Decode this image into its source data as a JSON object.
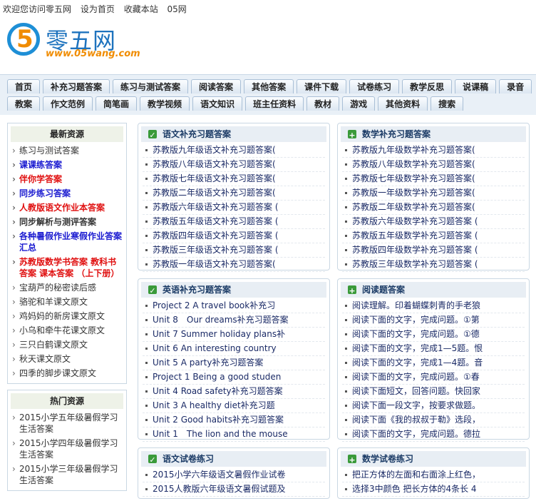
{
  "topbar": [
    "欢迎您访问零五网",
    "设为首页",
    "收藏本站",
    "05网"
  ],
  "logo": {
    "digit": "5",
    "name": "零五网",
    "domain": "www.05wang.com"
  },
  "nav": {
    "row1": [
      "首页",
      "补充习题答案",
      "练习与测试答案",
      "阅读答案",
      "其他答案",
      "课件下载",
      "试卷练习",
      "教学反思",
      "说课稿",
      "录音"
    ],
    "row2": [
      "教案",
      "作文范例",
      "简笔画",
      "教学视频",
      "语文知识",
      "班主任资料",
      "教材",
      "游戏",
      "其他资料",
      "搜索"
    ]
  },
  "sidebar": {
    "latest": {
      "title": "最新资源",
      "items": [
        {
          "text": "练习与测试答案",
          "style": "plain"
        },
        {
          "text": "课课练答案",
          "style": "blue"
        },
        {
          "text": "伴你学答案",
          "style": "red"
        },
        {
          "text": "同步练习答案",
          "style": "blue"
        },
        {
          "text": "人教版语文作业本答案",
          "style": "red"
        },
        {
          "text": "同步解析与测评答案",
          "style": "bold"
        },
        {
          "text": "各种暑假作业寒假作业答案汇总",
          "style": "blue"
        },
        {
          "text": "苏教版数学书答案 教科书答案 课本答案 （上下册）",
          "style": "red"
        },
        {
          "text": "宝葫芦的秘密读后感",
          "style": "plain"
        },
        {
          "text": "骆驼和羊课文原文",
          "style": "plain"
        },
        {
          "text": "鸡妈妈的新房课文原文",
          "style": "plain"
        },
        {
          "text": "小乌和牵牛花课文原文",
          "style": "plain"
        },
        {
          "text": "三只白鹤课文原文",
          "style": "plain"
        },
        {
          "text": "秋天课文原文",
          "style": "plain"
        },
        {
          "text": "四季的脚步课文原文",
          "style": "plain"
        }
      ]
    },
    "hot": {
      "title": "热门资源",
      "items": [
        "2015小学五年级暑假学习生活答案",
        "2015小学四年级暑假学习生活答案",
        "2015小学三年级暑假学习生活答案"
      ]
    }
  },
  "panels": [
    {
      "title": "语文补充习题答案",
      "icon": "check-icon",
      "items": [
        "苏教版九年级语文补充习题答案(",
        "苏教版八年级语文补充习题答案(",
        "苏教版七年级语文补充习题答案(",
        "苏教版二年级语文补充习题答案(",
        "苏教版六年级语文补充习题答案 (",
        "苏教版五年级语文补充习题答案 (",
        "苏教版四年级语文补充习题答案 (",
        "苏教版三年级语文补充习题答案 (",
        "苏教版一年级语文补充习题答案("
      ]
    },
    {
      "title": "数学补充习题答案",
      "icon": "plus-icon",
      "items": [
        "苏教版九年级数学补充习题答案(",
        "苏教版八年级数学补充习题答案(",
        "苏教版七年级数学补充习题答案(",
        "苏教版一年级数学补充习题答案(",
        "苏教版二年级数学补充习题答案(",
        "苏教版六年级数学补充习题答案 (",
        "苏教版五年级数学补充习题答案 (",
        "苏教版四年级数学补充习题答案 (",
        "苏教版三年级数学补充习题答案 ("
      ]
    },
    {
      "title": "英语补充习题答案",
      "icon": "check-icon",
      "items": [
        "Project 2 A travel book补充习",
        "Unit 8　Our dreams补充习题答案",
        "Unit 7 Summer holiday plans补",
        "Unit 6 An interesting country",
        "Unit 5 A party补充习题答案",
        "Project 1 Being a good studen",
        "Unit 4 Road safety补充习题答案",
        "Unit 3 A healthy diet补充习题",
        "Unit 2 Good habits补充习题答案",
        "Unit 1　The lion and the mouse"
      ]
    },
    {
      "title": "阅读题答案",
      "icon": "plus-icon",
      "items": [
        "阅读理解。印着蝴蝶刺青的手老狼",
        "阅读下面的文字，完成问题。①第",
        "阅读下面的文字，完成问题。①德",
        "阅读下面的文字，完成1—5题。恨",
        "阅读下面的文字，完成1—4题。音",
        "阅读下面的文字，完成问题。①春",
        "阅读下面短文，回答问题。快回家",
        "阅读下面一段文字，按要求做题。",
        "阅读下面《我的叔叔于勒》选段，",
        "阅读下面的文字，完成问题。德拉"
      ]
    },
    {
      "title": "语文试卷练习",
      "icon": "check-icon",
      "items": [
        "2015小学六年级语文暑假作业试卷",
        "2015人教版六年级语文暑假试题及"
      ]
    },
    {
      "title": "数学试卷练习",
      "icon": "plus-icon",
      "items": [
        "把正方体的左面和右面涂上红色，",
        "选择3中颜色 把长方体的4条长 4"
      ]
    }
  ]
}
